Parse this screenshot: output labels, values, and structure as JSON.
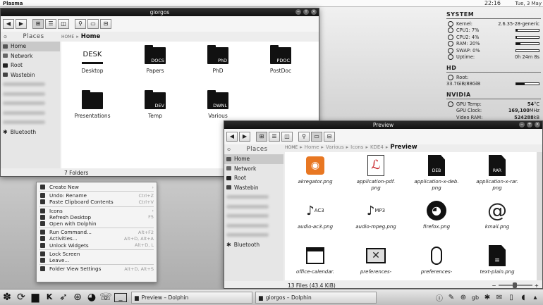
{
  "top_panel": {
    "app": "Plasma",
    "time": "22:16",
    "date": "Tue, 3 May"
  },
  "system_monitor": {
    "system": {
      "title": "SYSTEM",
      "rows": [
        {
          "label": "Kernel:",
          "value": "2.6.35-28-generic"
        },
        {
          "label": "CPU1: 7%",
          "bar": 0.07
        },
        {
          "label": "CPU2: 4%",
          "bar": 0.04
        },
        {
          "label": "RAM: 20%",
          "bar": 0.2
        },
        {
          "label": "SWAP: 0%",
          "bar": 0.0
        },
        {
          "label": "Uptime:",
          "value": "0h 24m 8s"
        }
      ]
    },
    "hd": {
      "title": "HD",
      "root_label": "Root:",
      "usage": "33.7GiB/88GiB",
      "bar": 0.38
    },
    "nvidia": {
      "title": "NVIDIA",
      "rows": [
        {
          "label": "GPU Temp:",
          "value": "54",
          "unit": "°C"
        },
        {
          "label": "GPU Clock:",
          "value": "169,100",
          "unit": "MHz"
        },
        {
          "label": "Video RAM:",
          "value": "524288",
          "unit": "kB"
        }
      ]
    }
  },
  "dolphin_main": {
    "title": "giorgos",
    "places_label": "Places",
    "breadcrumb": {
      "home_icon": "HOME",
      "current": "Home"
    },
    "sidebar": [
      {
        "label": "Home",
        "icon": "home-icon",
        "selected": true
      },
      {
        "label": "Network",
        "icon": "network-icon"
      },
      {
        "label": "Root",
        "icon": "folder-icon"
      },
      {
        "label": "Wastebin",
        "icon": "trash-icon"
      },
      {
        "label": "Bluetooth",
        "icon": "bluetooth-icon"
      }
    ],
    "items": [
      {
        "name": "Desktop",
        "tag": "DESK"
      },
      {
        "name": "Papers",
        "tag": "DOCS"
      },
      {
        "name": "PhD",
        "tag": "PhD"
      },
      {
        "name": "PostDoc",
        "tag": "PDOC"
      },
      {
        "name": "Presentations",
        "tag": ""
      },
      {
        "name": "Temp",
        "tag": "DEV"
      },
      {
        "name": "Various",
        "tag": "DWNL"
      }
    ],
    "status": "7 Folders"
  },
  "dolphin_preview": {
    "title": "Preview",
    "places_label": "Places",
    "breadcrumb": {
      "home_icon": "HOME",
      "parts": [
        "Home",
        "Various",
        "Icons",
        "KDE4"
      ],
      "current": "Preview"
    },
    "sidebar": [
      {
        "label": "Home",
        "icon": "home-icon",
        "selected": true
      },
      {
        "label": "Network",
        "icon": "network-icon"
      },
      {
        "label": "Root",
        "icon": "folder-icon"
      },
      {
        "label": "Wastebin",
        "icon": "trash-icon"
      },
      {
        "label": "Bluetooth",
        "icon": "bluetooth-icon"
      }
    ],
    "files": [
      {
        "name": "akregator.png",
        "icon": "rss-icon"
      },
      {
        "name": "application-pdf.\npng",
        "icon": "pdf-icon"
      },
      {
        "name": "application-x-deb.\npng",
        "icon": "deb-icon",
        "tag": "DEB"
      },
      {
        "name": "application-x-rar.\npng",
        "icon": "rar-icon",
        "tag": "RAR"
      },
      {
        "name": "audio-ac3.png",
        "icon": "music-ac3-icon",
        "tag": "AC3"
      },
      {
        "name": "audio-mpeg.png",
        "icon": "music-mp3-icon",
        "tag": "MP3"
      },
      {
        "name": "firefox.png",
        "icon": "firefox-icon"
      },
      {
        "name": "kmail.png",
        "icon": "at-icon"
      },
      {
        "name": "office-calendar.",
        "icon": "calendar-icon"
      },
      {
        "name": "preferences-",
        "icon": "display-icon"
      },
      {
        "name": "preferences-",
        "icon": "mouse-icon"
      },
      {
        "name": "text-plain.png",
        "icon": "text-file-icon"
      }
    ],
    "status": "13 Files (43.4 KiB)"
  },
  "context_menu": {
    "items": [
      {
        "label": "Create New",
        "submenu": true,
        "icon": "new-icon"
      },
      {
        "separator": true
      },
      {
        "label": "Undo: Rename",
        "shortcut": "Ctrl+Z",
        "icon": "undo-icon"
      },
      {
        "label": "Paste Clipboard Contents",
        "shortcut": "Ctrl+V",
        "icon": "paste-icon"
      },
      {
        "separator": true
      },
      {
        "label": "Icons",
        "submenu": true,
        "icon": "icons-icon"
      },
      {
        "label": "Refresh Desktop",
        "shortcut": "F5",
        "icon": "refresh-icon"
      },
      {
        "label": "Open with Dolphin",
        "icon": "folder-icon"
      },
      {
        "separator": true
      },
      {
        "label": "Run Command...",
        "shortcut": "Alt+F2",
        "icon": "run-icon"
      },
      {
        "label": "Activities...",
        "shortcut": "Alt+D, Alt+A",
        "icon": "activities-icon"
      },
      {
        "label": "Unlock Widgets",
        "shortcut": "Alt+D, L",
        "icon": "unlock-icon"
      },
      {
        "separator": true
      },
      {
        "label": "Lock Screen",
        "icon": "lock-icon"
      },
      {
        "label": "Leave...",
        "icon": "leave-icon"
      },
      {
        "separator": true
      },
      {
        "label": "Folder View Settings",
        "shortcut": "Alt+D, Alt+S",
        "icon": "settings-icon"
      }
    ]
  },
  "taskbar": {
    "launchers": [
      "kde-icon",
      "refresh-icon",
      "folder-icon",
      "kopete-icon",
      "bird-icon",
      "ubuntu-icon",
      "firefox-icon",
      "phone-icon",
      "terminal-icon"
    ],
    "tasks": [
      {
        "label": "Preview – Dolphin"
      },
      {
        "label": "giorgos – Dolphin"
      }
    ],
    "tray": [
      "info-icon",
      "tools-icon",
      "network-icon",
      "keyboard-gb-icon",
      "bluetooth-icon",
      "mail-icon",
      "battery-icon",
      "volume-icon",
      "arrow-icon"
    ]
  }
}
